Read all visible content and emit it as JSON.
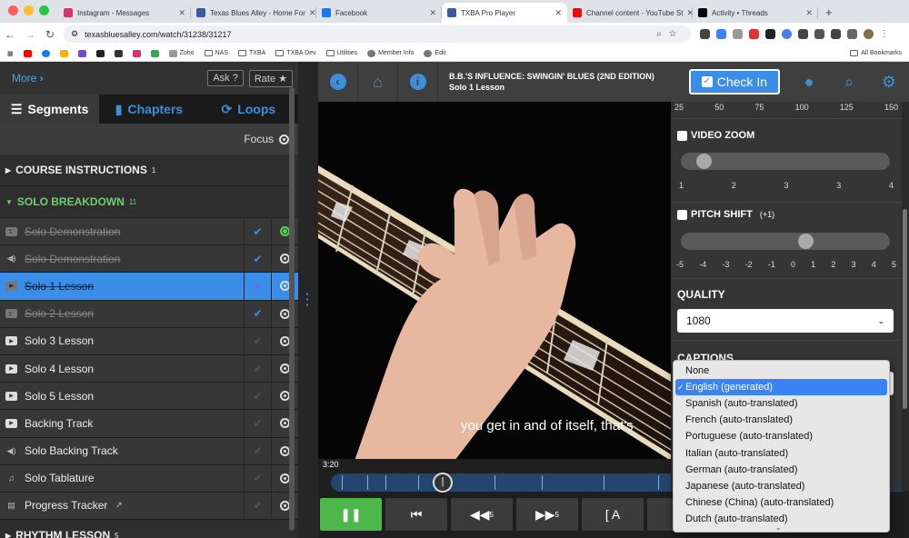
{
  "browser": {
    "tabs": [
      {
        "title": "Instagram - Messages",
        "fav": "#d6336c"
      },
      {
        "title": "Texas Blues Alley - Home For",
        "fav": "#3a5a9a"
      },
      {
        "title": "Facebook",
        "fav": "#1877f2"
      },
      {
        "title": "TXBA Pro Player",
        "fav": "#3a5a9a",
        "active": true
      },
      {
        "title": "Channel content - YouTube St",
        "fav": "#ff0000"
      },
      {
        "title": "Activity • Threads",
        "fav": "#000000"
      }
    ],
    "url": "texasbluesalley.com/watch/31238/31217",
    "bookmarks": [
      "Zoho",
      "NAS",
      "TXBA",
      "TXBA Dev",
      "Utilities",
      "Member Info",
      "Edit"
    ],
    "all_bookmarks": "All Bookmarks"
  },
  "left": {
    "more": "More",
    "ask": "Ask ?",
    "rate": "Rate ★",
    "tabs": [
      "Segments",
      "Chapters",
      "Loops"
    ],
    "focus": "Focus",
    "sections": [
      {
        "title": "COURSE INSTRUCTIONS",
        "count": "1"
      },
      {
        "title": "SOLO BREAKDOWN",
        "count": "11"
      },
      {
        "title": "RHYTHM LESSON",
        "count": "5"
      }
    ],
    "rows": [
      {
        "label": "Solo Demonstration",
        "icon": "play",
        "state": "done",
        "radio": "green"
      },
      {
        "label": "Solo Demonstration",
        "icon": "audio",
        "state": "done"
      },
      {
        "label": "Solo 1 Lesson",
        "icon": "play",
        "state": "selected"
      },
      {
        "label": "Solo 2 Lesson",
        "icon": "play",
        "state": "done"
      },
      {
        "label": "Solo 3 Lesson",
        "icon": "play",
        "state": "todo"
      },
      {
        "label": "Solo 4 Lesson",
        "icon": "play",
        "state": "todo"
      },
      {
        "label": "Solo 5 Lesson",
        "icon": "play",
        "state": "todo"
      },
      {
        "label": "Backing Track",
        "icon": "play",
        "state": "todo"
      },
      {
        "label": "Solo Backing Track",
        "icon": "audio",
        "state": "todo"
      },
      {
        "label": "Solo Tablature",
        "icon": "music",
        "state": "todo"
      },
      {
        "label": "Progress Tracker",
        "icon": "doc",
        "state": "todo",
        "external": true
      }
    ]
  },
  "header": {
    "course": "B.B.'S INFLUENCE: SWINGIN' BLUES (2ND EDITION)",
    "lesson": "Solo 1 Lesson",
    "checkin": "Check In"
  },
  "video": {
    "subtitle": "you get in and of itself, that's",
    "time": "3:20",
    "progress": 0.2
  },
  "controls": {
    "back5": "5",
    "fwd5": "5",
    "loop_a": "[ A"
  },
  "settings": {
    "speed_ticks": [
      "25",
      "50",
      "75",
      "100",
      "125",
      "150"
    ],
    "video_zoom": "VIDEO ZOOM",
    "zoom_ticks": [
      "1",
      "2",
      "3",
      "3",
      "4"
    ],
    "zoom_level": 0.07,
    "pitch_shift": "PITCH SHIFT",
    "pitch_value": "(+1)",
    "pitch_ticks": [
      "-5",
      "-4",
      "-3",
      "-2",
      "-1",
      "0",
      "1",
      "2",
      "3",
      "4",
      "5"
    ],
    "pitch_level": 0.6,
    "quality_label": "QUALITY",
    "quality": "1080",
    "captions_label": "CAPTIONS"
  },
  "captions_menu": {
    "options": [
      "None",
      "English (generated)",
      "Spanish (auto-translated)",
      "French (auto-translated)",
      "Portuguese (auto-translated)",
      "Italian (auto-translated)",
      "German (auto-translated)",
      "Japanese (auto-translated)",
      "Chinese (China) (auto-translated)",
      "Dutch (auto-translated)"
    ],
    "selected": 1
  }
}
